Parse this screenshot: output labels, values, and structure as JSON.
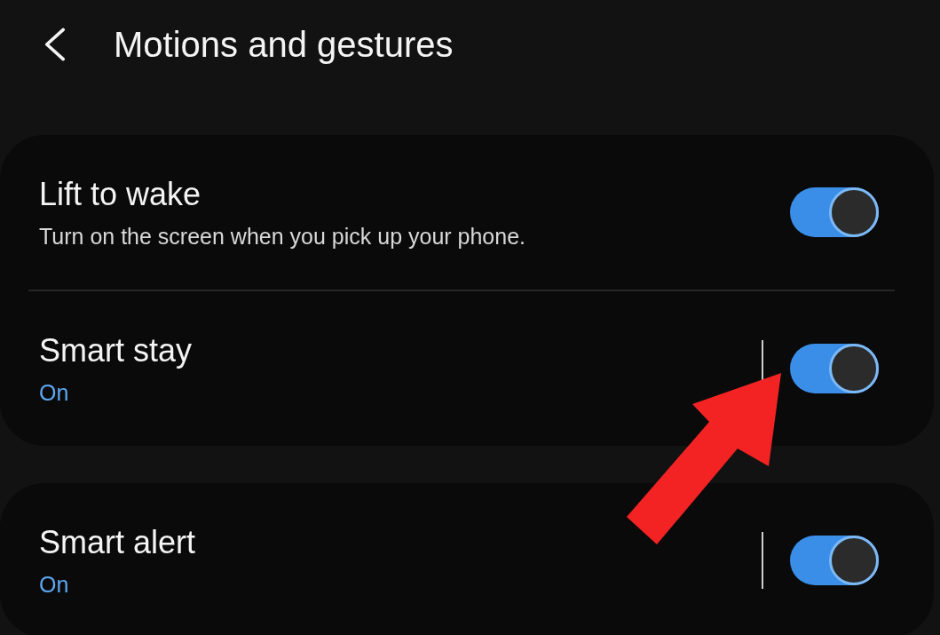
{
  "header": {
    "title": "Motions and gestures"
  },
  "cards": [
    {
      "items": [
        {
          "kind": "toggle",
          "title": "Lift to wake",
          "subtitle": {
            "kind": "description",
            "text": "Turn on the screen when you pick up your phone."
          },
          "on": true
        },
        {
          "kind": "split_toggle",
          "title": "Smart stay",
          "subtitle": {
            "kind": "status",
            "text": "On"
          },
          "on": true
        }
      ]
    },
    {
      "items": [
        {
          "kind": "split_toggle",
          "title": "Smart alert",
          "subtitle": {
            "kind": "status",
            "text": "On"
          },
          "on": true
        }
      ]
    }
  ]
}
